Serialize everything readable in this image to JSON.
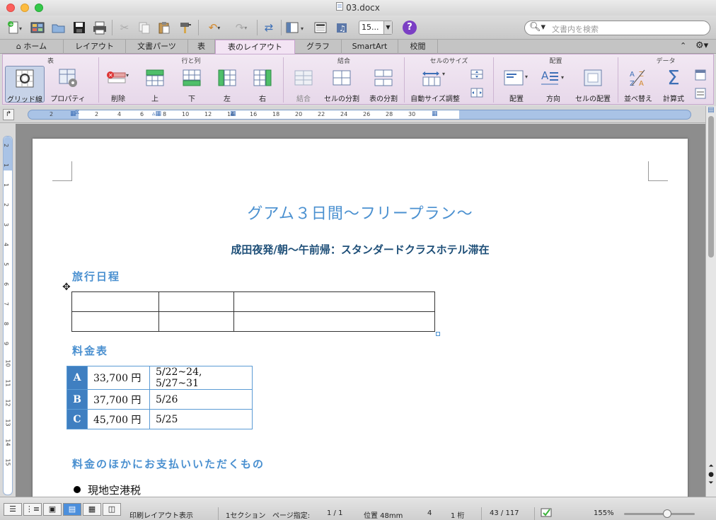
{
  "window": {
    "title": "03.docx"
  },
  "toolbar": {
    "zoom_value": "15...",
    "search_placeholder": "文書内を検索"
  },
  "tabs": [
    {
      "label": "ホーム",
      "icon": "home-icon"
    },
    {
      "label": "レイアウト"
    },
    {
      "label": "文書パーツ"
    },
    {
      "label": "表"
    },
    {
      "label": "表のレイアウト",
      "active": true
    },
    {
      "label": "グラフ"
    },
    {
      "label": "SmartArt"
    },
    {
      "label": "校閲"
    }
  ],
  "ribbon": {
    "groups": [
      "表",
      "行と列",
      "結合",
      "セルのサイズ",
      "配置",
      "データ"
    ],
    "buttons": {
      "gridlines": "グリッド線",
      "properties": "プロパティ",
      "delete": "削除",
      "above": "上",
      "below": "下",
      "left": "左",
      "right": "右",
      "merge": "結合",
      "split_cells": "セルの分割",
      "split_table": "表の分割",
      "autofit": "自動サイズ調整",
      "align": "配置",
      "direction": "方向",
      "cell_align": "セルの配置",
      "sort": "並べ替え",
      "formula": "計算式"
    }
  },
  "ruler": {
    "h_ticks": [
      "2",
      "2",
      "4",
      "6",
      "8",
      "10",
      "12",
      "14",
      "16",
      "18",
      "20",
      "22",
      "24",
      "26",
      "28",
      "30"
    ],
    "v_ticks": [
      "2",
      "1",
      "1",
      "2",
      "3",
      "4",
      "5",
      "6",
      "7",
      "8",
      "9",
      "10",
      "11",
      "12",
      "13",
      "14",
      "15"
    ]
  },
  "document": {
    "title": "グアム３日間～フリープラン～",
    "subtitle": "成田夜発/朝～午前帰：スタンダードクラスホテル滞在",
    "heading_itinerary": "旅行日程",
    "heading_price": "料金表",
    "heading_other": "料金のほかにお支払いいただくもの",
    "price_rows": [
      {
        "label": "A",
        "amount": "33,700 円",
        "dates": "5/22~24, 5/27~31"
      },
      {
        "label": "B",
        "amount": "37,700 円",
        "dates": "5/26"
      },
      {
        "label": "C",
        "amount": "45,700 円",
        "dates": "5/25"
      }
    ],
    "bullets": [
      "現地空港税"
    ]
  },
  "status": {
    "view_mode": "印刷レイアウト表示",
    "section": "1セクション",
    "page_label": "ページ指定:",
    "page_value": "1 / 1",
    "position": "位置 48mm",
    "line": "4",
    "column": "1 桁",
    "word_count": "43 / 117",
    "zoom": "155%"
  }
}
